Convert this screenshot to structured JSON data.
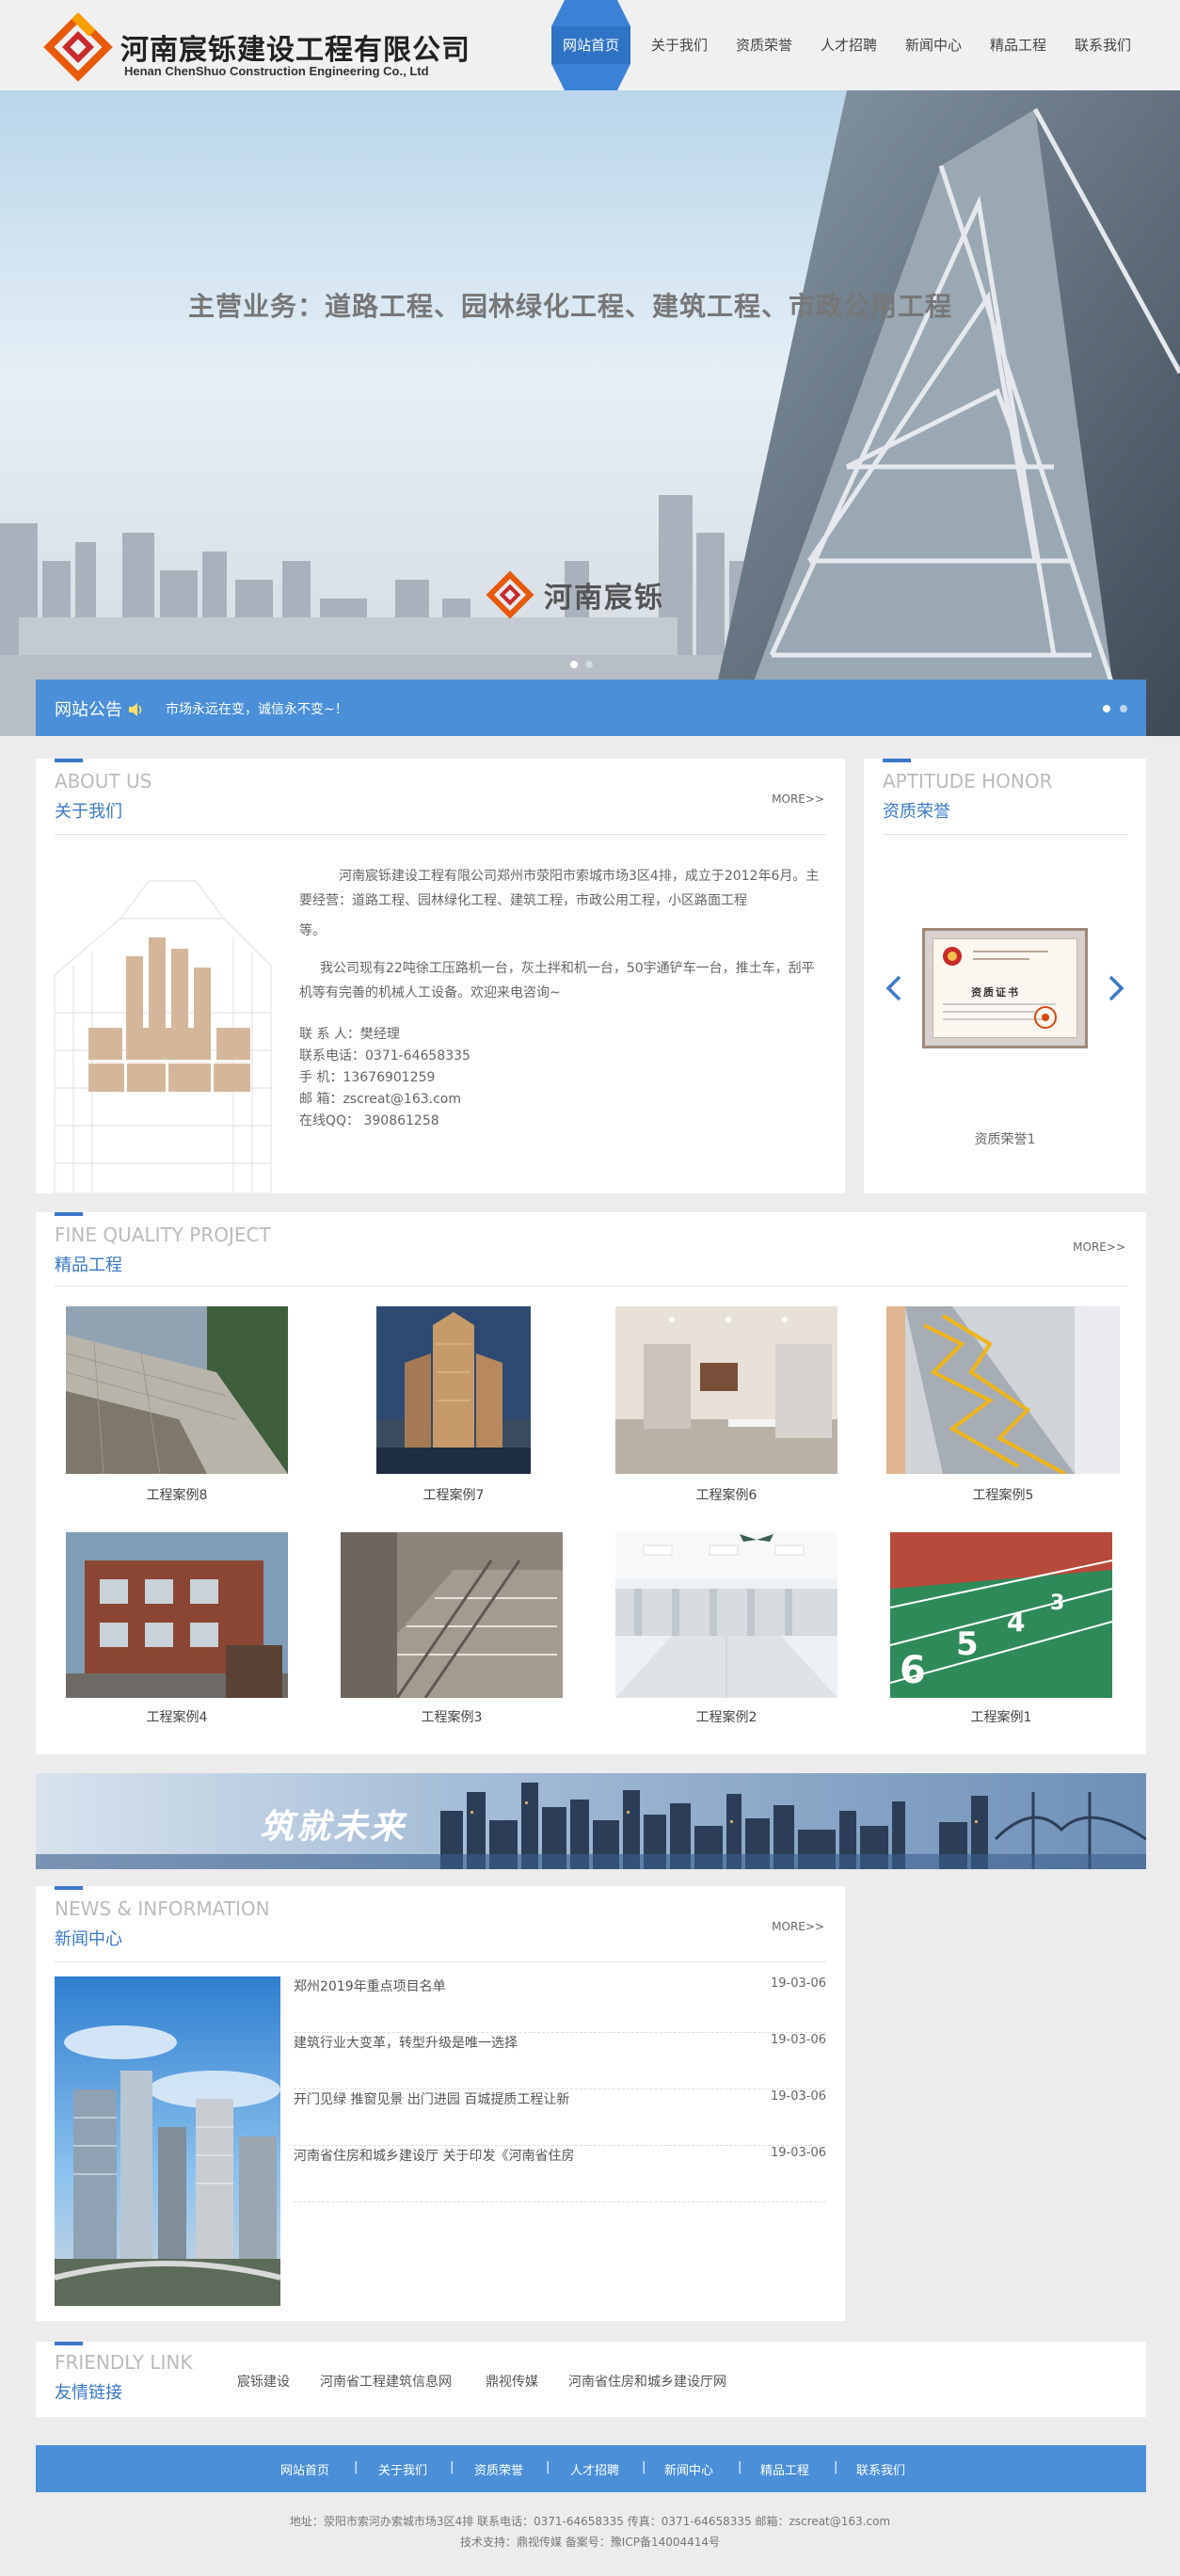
{
  "header": {
    "company_cn": "河南宸铄建设工程有限公司",
    "company_en": "Henan ChenShuo Construction Engineering Co., Ltd"
  },
  "nav": {
    "items": [
      {
        "label": "网站首页",
        "active": true
      },
      {
        "label": "关于我们"
      },
      {
        "label": "资质荣誉"
      },
      {
        "label": "人才招聘"
      },
      {
        "label": "新闻中心"
      },
      {
        "label": "精品工程"
      },
      {
        "label": "联系我们"
      }
    ]
  },
  "banner": {
    "slogan": "主营业务：道路工程、园林绿化工程、建筑工程、市政公用工程",
    "brand": "河南宸铄"
  },
  "notice": {
    "title": "网站公告",
    "text": "市场永远在变，诚信永不变~！"
  },
  "about": {
    "title_en": "ABOUT US",
    "title_cn": "关于我们",
    "more": "MORE>>",
    "p1": "河南宸铄建设工程有限公司郑州市荥阳市索城市场3区4排，成立于2012年6月。主要经营：道路工程、园林绿化工程、建筑工程，市政公用工程，小区路面工程",
    "p1b": "等。",
    "p2": "我公司现有22吨徐工压路机一台，灰土拌和机一台，50宇通铲车一台，推土车，刮平机等有完善的机械人工设备。欢迎来电咨询~",
    "contacts": [
      "联 系 人：樊经理",
      "联系电话：0371-64658335",
      "手 机：13676901259",
      "邮 箱：zscreat@163.com",
      "在线QQ： 390861258"
    ]
  },
  "aptitude": {
    "title_en": "APTITUDE HONOR",
    "title_cn": "资质荣誉",
    "caption": "资质荣誉1",
    "cert_text": "资质证书"
  },
  "projects": {
    "title_en": "FINE QUALITY PROJECT",
    "title_cn": "精品工程",
    "more": "MORE>>",
    "items": [
      {
        "caption": "工程案例8"
      },
      {
        "caption": "工程案例7"
      },
      {
        "caption": "工程案例6"
      },
      {
        "caption": "工程案例5"
      },
      {
        "caption": "工程案例4"
      },
      {
        "caption": "工程案例3"
      },
      {
        "caption": "工程案例2"
      },
      {
        "caption": "工程案例1"
      }
    ]
  },
  "mid_banner": {
    "text": "筑就未来"
  },
  "news": {
    "title_en": "NEWS & INFORMATION",
    "title_cn": "新闻中心",
    "more": "MORE>>",
    "items": [
      {
        "title": "郑州2019年重点项目名单",
        "date": "19-03-06"
      },
      {
        "title": "建筑行业大变革，转型升级是唯一选择",
        "date": "19-03-06"
      },
      {
        "title": "开门见绿 推窗见景 出门进园 百城提质工程让新",
        "date": "19-03-06"
      },
      {
        "title": "河南省住房和城乡建设厅 关于印发《河南省住房",
        "date": "19-03-06"
      }
    ]
  },
  "links": {
    "title_en": "FRIENDLY LINK",
    "title_cn": "友情链接",
    "items": [
      "宸铄建设",
      "河南省工程建筑信息网",
      "鼎视传媒",
      "河南省住房和城乡建设厅网"
    ]
  },
  "footer": {
    "nav": [
      "网站首页",
      "关于我们",
      "资质荣誉",
      "人才招聘",
      "新闻中心",
      "精品工程",
      "联系我们"
    ],
    "address_line": "地址：荥阳市索河办索城市场3区4排  联系电话：0371-64658335  传真：0371-64658335  邮箱：zscreat@163.com",
    "support_line": "技术支持：鼎视传媒   备案号：豫ICP备14004414号"
  },
  "colors": {
    "accent": "#4a8fd8",
    "title_blue": "#3a78c8",
    "logo_orange": "#e8590c",
    "logo_red": "#c92a2a"
  }
}
